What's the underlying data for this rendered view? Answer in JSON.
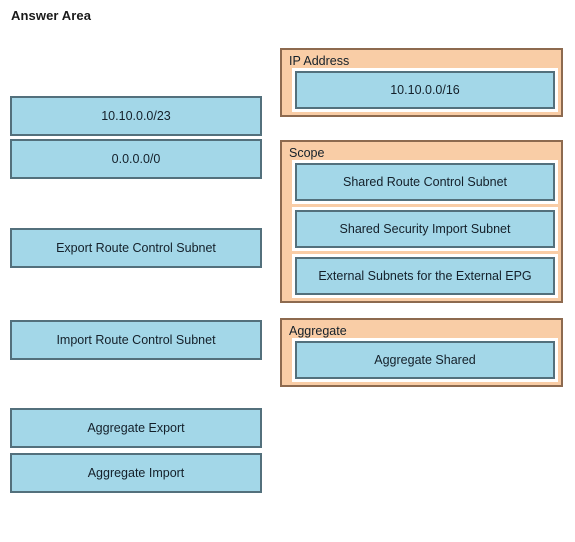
{
  "page": {
    "title": "Answer Area"
  },
  "colors": {
    "tile_fill": "#a3d7e8",
    "tile_border": "#53707c",
    "panel_fill": "#f9cda6",
    "panel_border": "#8d6a4f",
    "slot_outline": "#ffffff",
    "background": "#ffffff",
    "text": "#14202a"
  },
  "tiles": [
    {
      "label": "10.10.0.0/23"
    },
    {
      "label": "0.0.0.0/0"
    },
    {
      "label": "Export Route Control Subnet"
    },
    {
      "label": "Import Route Control Subnet"
    },
    {
      "label": "Aggregate Export"
    },
    {
      "label": "Aggregate Import"
    }
  ],
  "panels": [
    {
      "label": "IP Address",
      "slots": [
        {
          "label": "10.10.0.0/16"
        }
      ]
    },
    {
      "label": "Scope",
      "slots": [
        {
          "label": "Shared Route Control Subnet"
        },
        {
          "label": "Shared Security Import Subnet"
        },
        {
          "label": "External Subnets for the External EPG"
        }
      ]
    },
    {
      "label": "Aggregate",
      "slots": [
        {
          "label": "Aggregate Shared"
        }
      ]
    }
  ]
}
